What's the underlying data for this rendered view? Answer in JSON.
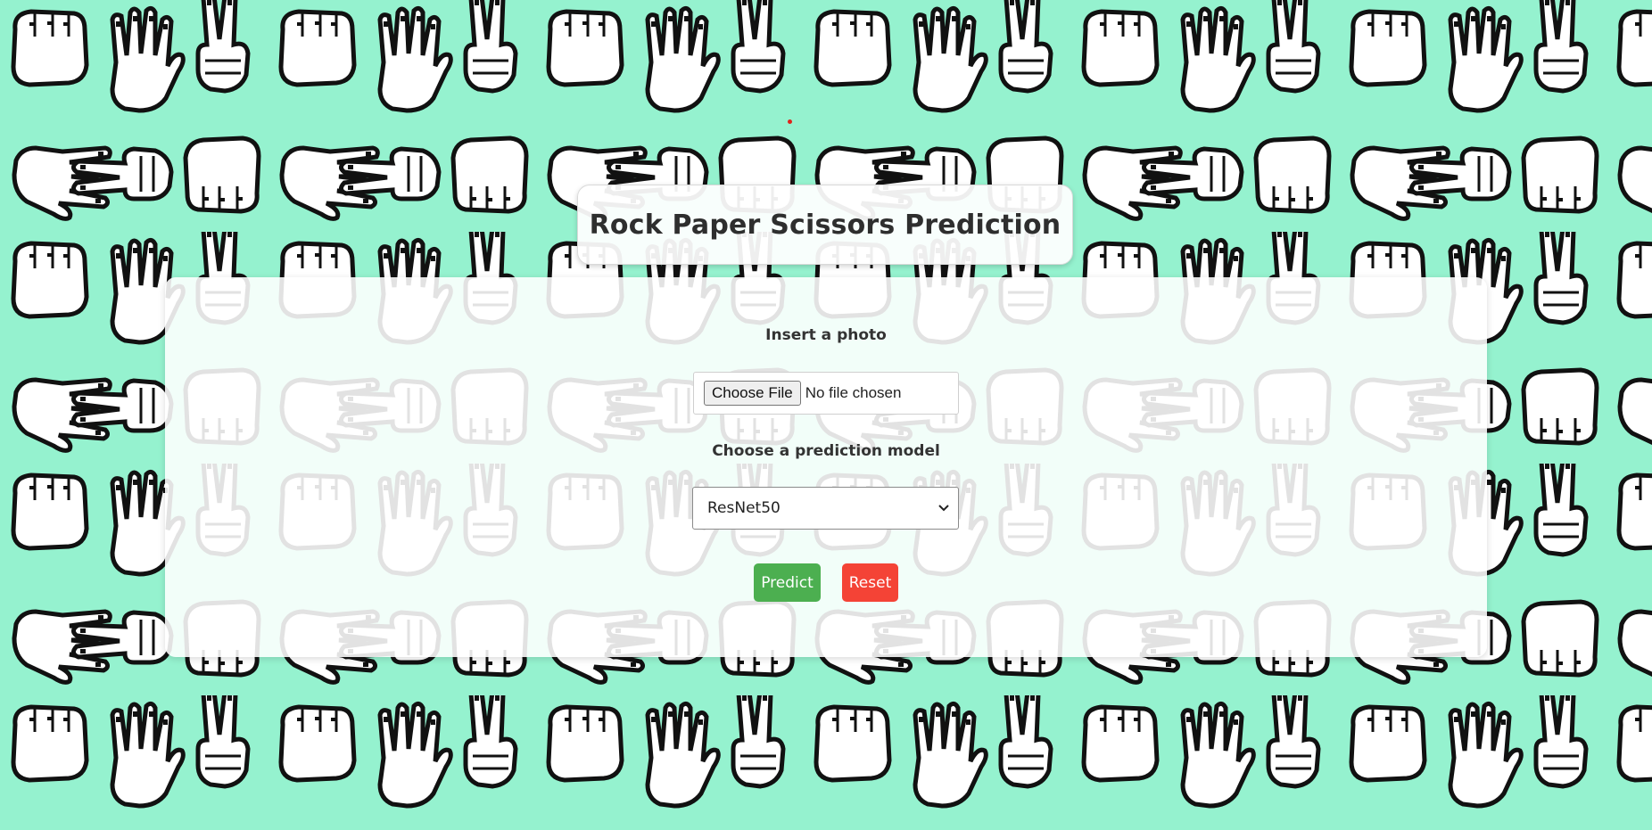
{
  "page": {
    "title": "Rock Paper Scissors Prediction",
    "background_color": "#95f2cf",
    "background_pattern": "hand-gestures-pattern"
  },
  "form": {
    "photo_label": "Insert a photo",
    "file_button_label": "Choose File",
    "file_status": "No file chosen",
    "model_label": "Choose a prediction model",
    "model_selected": "ResNet50",
    "predict_label": "Predict",
    "reset_label": "Reset"
  },
  "colors": {
    "predict_button": "#4caf50",
    "reset_button": "#f44336",
    "card_background": "#ffffff",
    "title_text": "#2e2e2e"
  }
}
